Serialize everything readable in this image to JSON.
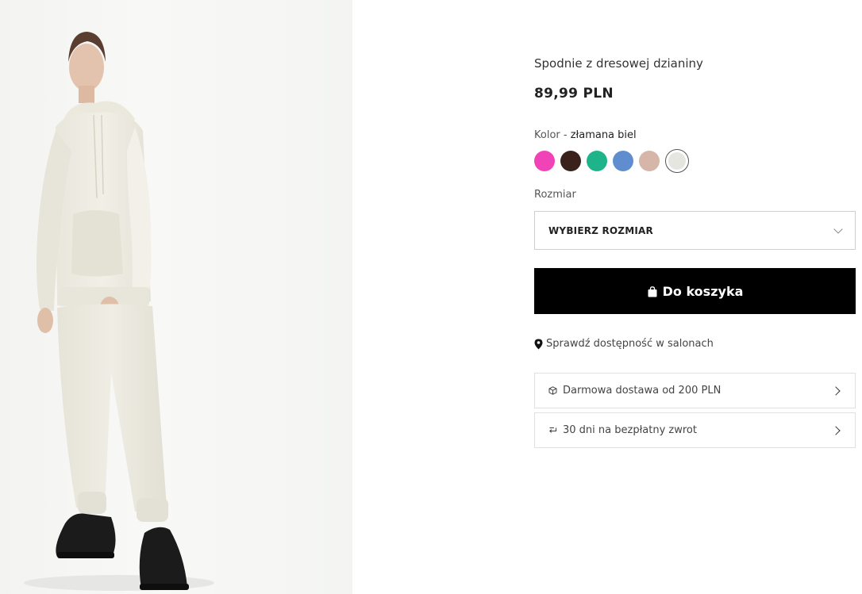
{
  "product": {
    "title": "Spodnie z dresowej dzianiny",
    "price": "89,99 PLN",
    "image_alt": "model in cream hoodie and sweatpants"
  },
  "color": {
    "label": "Kolor - ",
    "selected_name": "złamana biel",
    "swatches": [
      {
        "name": "pink",
        "hex": "#f043b7"
      },
      {
        "name": "dark-brown",
        "hex": "#3a211c"
      },
      {
        "name": "green",
        "hex": "#1db48a"
      },
      {
        "name": "blue",
        "hex": "#5f8dd0"
      },
      {
        "name": "beige",
        "hex": "#d5b6a8"
      },
      {
        "name": "off-white",
        "hex": "#e6e6e1",
        "selected": true
      }
    ]
  },
  "size": {
    "label": "Rozmiar",
    "placeholder": "WYBIERZ ROZMIAR"
  },
  "cart": {
    "button_label": "Do koszyka",
    "icon": "shopping-bag-icon"
  },
  "store_check": {
    "label": "Sprawdź dostępność w salonach",
    "icon": "location-pin-icon"
  },
  "info_rows": [
    {
      "label": "Darmowa dostawa od 200 PLN",
      "icon": "package-icon"
    },
    {
      "label": "30 dni na bezpłatny zwrot",
      "icon": "return-arrow-icon"
    }
  ],
  "colors": {
    "button_bg": "#000000",
    "button_text": "#ffffff",
    "border": "#cfcfcf"
  }
}
